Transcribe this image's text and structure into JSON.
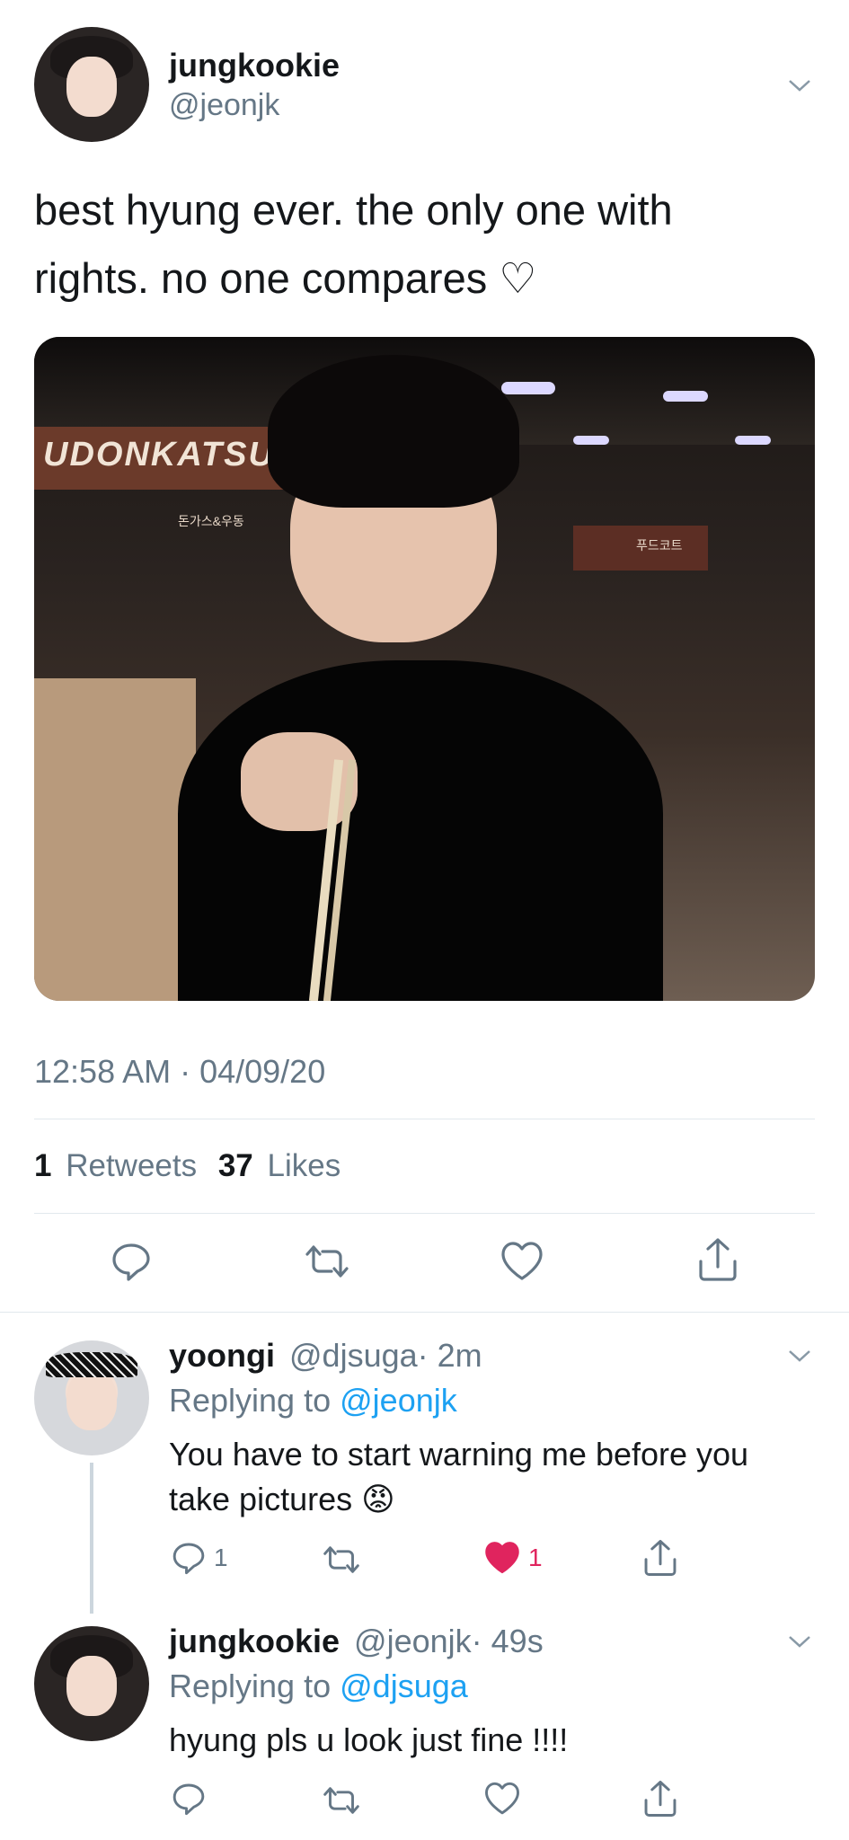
{
  "main_tweet": {
    "display_name": "jungkookie",
    "handle": "@jeonjk",
    "text": "best hyung ever. the only one with rights. no one compares ♡",
    "timestamp": "12:58 AM · 04/09/20",
    "retweets_count": "1",
    "retweets_label": "Retweets",
    "likes_count": "37",
    "likes_label": "Likes",
    "photo_sign": "UDONKATSU",
    "photo_subsign": "돈가스&우동",
    "photo_sign2": "푸드코트"
  },
  "replies": [
    {
      "display_name": "yoongi",
      "handle": "@djsuga",
      "time": "· 2m",
      "replying_label": "Replying to",
      "replying_to": "@jeonjk",
      "text": "You have to start warning me before you take pictures 😡",
      "reply_count": "1",
      "like_count": "1",
      "liked": true
    },
    {
      "display_name": "jungkookie",
      "handle": "@jeonjk",
      "time": "· 49s",
      "replying_label": "Replying to",
      "replying_to": "@djsuga",
      "text": "hyung pls u look just fine !!!!",
      "reply_count": "",
      "like_count": "",
      "liked": false
    }
  ],
  "colors": {
    "text": "#14171a",
    "secondary": "#657786",
    "link": "#1da1f2",
    "like_active": "#e0245e",
    "divider": "#e1e8ed"
  },
  "icons": [
    "chevron-down-icon",
    "reply-icon",
    "retweet-icon",
    "like-icon",
    "share-icon"
  ]
}
